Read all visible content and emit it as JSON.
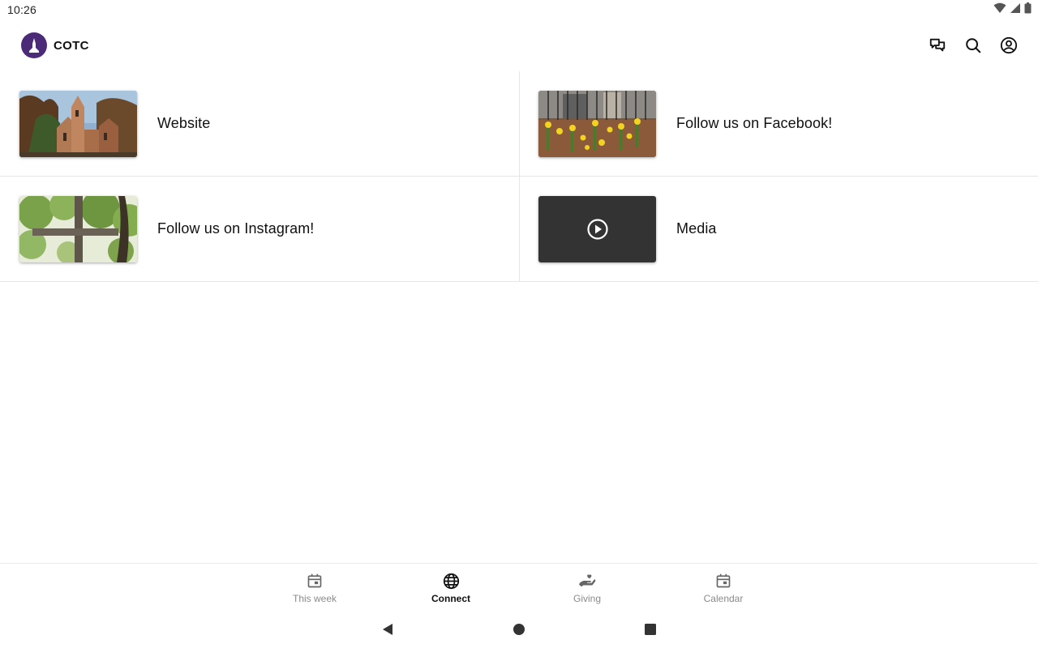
{
  "status_bar": {
    "time": "10:26",
    "icons": [
      "wifi-icon",
      "signal-icon",
      "battery-icon"
    ]
  },
  "app_bar": {
    "brand_name": "COTC",
    "brand_color": "#4b2a78",
    "actions": [
      "chat-icon",
      "search-icon",
      "account-icon"
    ]
  },
  "cards": [
    {
      "label": "Website",
      "thumbnail": "church-photo"
    },
    {
      "label": "Follow us on Facebook!",
      "thumbnail": "daffodils-photo"
    },
    {
      "label": "Follow us on Instagram!",
      "thumbnail": "cross-photo"
    },
    {
      "label": "Media",
      "thumbnail": "play-icon"
    }
  ],
  "bottom_nav": {
    "items": [
      {
        "label": "This week",
        "icon": "calendar-icon",
        "active": false
      },
      {
        "label": "Connect",
        "icon": "globe-icon",
        "active": true
      },
      {
        "label": "Giving",
        "icon": "giving-hand-icon",
        "active": false
      },
      {
        "label": "Calendar",
        "icon": "calendar-icon",
        "active": false
      }
    ]
  },
  "system_nav": [
    "back-icon",
    "home-icon",
    "recents-icon"
  ]
}
